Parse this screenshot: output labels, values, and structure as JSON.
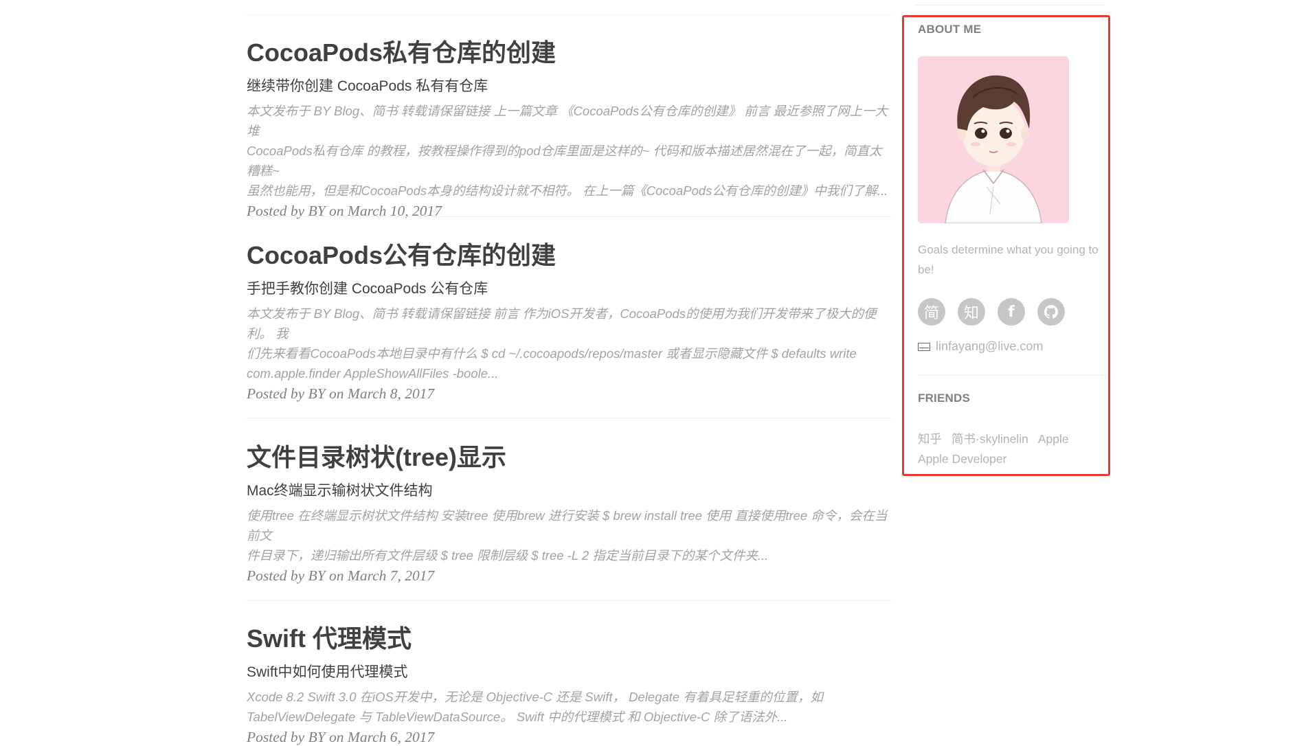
{
  "posts": [
    {
      "title": "CocoaPods私有仓库的创建",
      "subtitle": "继续带你创建 CocoaPods 私有有仓库",
      "excerpt": [
        "本文发布于 BY Blog、简书 转载请保留链接 上一篇文章 《CocoaPods公有仓库的创建》 前言 最近参照了网上一大堆",
        "CocoaPods私有仓库 的教程，按教程操作得到的pod仓库里面是这样的~ 代码和版本描述居然混在了一起，简直太糟糕~",
        "虽然也能用，但是和CocoaPods本身的结构设计就不相符。 在上一篇《CocoaPods公有仓库的创建》中我们了解..."
      ],
      "meta_prefix": "Posted by ",
      "author": "BY",
      "meta_mid": " on ",
      "date": "March 10, 2017"
    },
    {
      "title": "CocoaPods公有仓库的创建",
      "subtitle": "手把手教你创建 CocoaPods 公有仓库",
      "excerpt": [
        "本文发布于 BY Blog、简书 转载请保留链接 前言 作为iOS开发者，CocoaPods的使用为我们开发带来了极大的便利。 我",
        "们先来看看CocoaPods本地目录中有什么 $ cd ~/.cocoapods/repos/master 或者显示隐藏文件 $ defaults write",
        "com.apple.finder AppleShowAllFiles -boole..."
      ],
      "meta_prefix": "Posted by ",
      "author": "BY",
      "meta_mid": " on ",
      "date": "March 8, 2017"
    },
    {
      "title": "文件目录树状(tree)显示",
      "subtitle": "Mac终端显示输树状文件结构",
      "excerpt": [
        "使用tree 在终端显示树状文件结构 安装tree 使用brew 进行安装 $ brew install tree 使用 直接使用tree 命令，会在当前文",
        "件目录下，递归输出所有文件层级 $ tree 限制层级 $ tree -L 2 指定当前目录下的某个文件夹..."
      ],
      "meta_prefix": "Posted by ",
      "author": "BY",
      "meta_mid": " on ",
      "date": "March 7, 2017"
    },
    {
      "title": "Swift 代理模式",
      "subtitle": "Swift中如何使用代理模式",
      "excerpt": [
        "Xcode 8.2 Swift 3.0 在iOS开发中，无论是 Objective-C 还是 Swift， Delegate 有着具足轻重的位置，如",
        "TabelViewDelegate 与 TableViewDataSource。 Swift 中的代理模式 和 Objective-C 除了语法外..."
      ],
      "meta_prefix": "Posted by ",
      "author": "BY",
      "meta_mid": " on ",
      "date": "March 6, 2017"
    }
  ],
  "sidebar": {
    "about_heading": "ABOUT ME",
    "motto": "Goals determine what you going to be!",
    "social": [
      {
        "label": "简",
        "icon": "jianshu-icon"
      },
      {
        "label": "知",
        "icon": "zhihu-icon"
      },
      {
        "label": "f",
        "icon": "facebook-icon"
      },
      {
        "label": "",
        "icon": "github-icon"
      }
    ],
    "email": "linfayang@live.com",
    "friends_heading": "FRIENDS",
    "friends": [
      "知乎",
      "简书·skylinelin",
      "Apple",
      "Apple Developer"
    ]
  },
  "colors": {
    "highlight_border": "#e53935",
    "social_bg": "#c6c6c6",
    "avatar_bg": "#fbd6df"
  }
}
